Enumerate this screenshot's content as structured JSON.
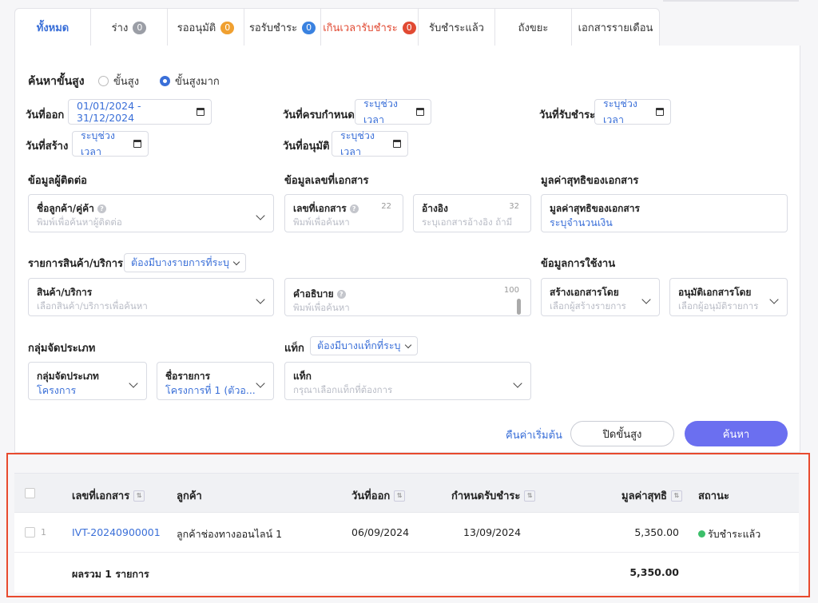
{
  "tabs": [
    {
      "label": "ทั้งหมด"
    },
    {
      "label": "ร่าง",
      "badge": "0",
      "badge_color": "#9b9ea6"
    },
    {
      "label": "รออนุมัติ",
      "badge": "0",
      "badge_color": "#f0a030"
    },
    {
      "label": "รอรับชำระ",
      "badge": "0",
      "badge_color": "#3a82e0"
    },
    {
      "label": "เกินเวลารับชำระ",
      "badge": "0",
      "badge_color": "#e14a33"
    },
    {
      "label": "รับชำระแล้ว"
    },
    {
      "label": "ถังขยะ"
    },
    {
      "label": "เอกสารรายเดือน"
    }
  ],
  "search": {
    "title": "ค้นหาขั้นสูง",
    "mode_advanced": "ขั้นสูง",
    "mode_very_advanced": "ขั้นสูงมาก",
    "issue_date_label": "วันที่ออก",
    "issue_date_value": "01/01/2024 - 31/12/2024",
    "due_date_label": "วันที่ครบกำหนด",
    "due_date_value": "ระบุช่วงเวลา",
    "paid_date_label": "วันที่รับชำระ",
    "paid_date_value": "ระบุช่วงเวลา",
    "created_date_label": "วันที่สร้าง",
    "created_date_value": "ระบุช่วงเวลา",
    "approved_date_label": "วันที่อนุมัติ",
    "approved_date_value": "ระบุช่วงเวลา",
    "contact_section": "ข้อมูลผู้ติดต่อ",
    "doc_section": "ข้อมูลเลขที่เอกสาร",
    "net_section": "มูลค่าสุทธิของเอกสาร",
    "customer_label": "ชื่อลูกค้า/คู่ค้า",
    "customer_placeholder": "พิมพ์เพื่อค้นหาผู้ติดต่อ",
    "docno_label": "เลขที่เอกสาร",
    "docno_count": "22",
    "docno_placeholder": "พิมพ์เพื่อค้นหา",
    "ref_label": "อ้างอิง",
    "ref_count": "32",
    "ref_placeholder": "ระบุเอกสารอ้างอิง ถ้ามี",
    "net_label": "มูลค่าสุทธิของเอกสาร",
    "net_value": "ระบุจำนวนเงิน",
    "product_section": "รายการสินค้า/บริการ",
    "product_filter": "ต้องมีบางรายการที่ระบุ",
    "usage_section": "ข้อมูลการใช้งาน",
    "product_label": "สินค้า/บริการ",
    "product_placeholder": "เลือกสินค้า/บริการเพื่อค้นหา",
    "desc_label": "คำอธิบาย",
    "desc_count": "100",
    "desc_placeholder": "พิมพ์เพื่อค้นหา",
    "createdby_label": "สร้างเอกสารโดย",
    "createdby_placeholder": "เลือกผู้สร้างรายการ",
    "approvedby_label": "อนุมัติเอกสารโดย",
    "approvedby_placeholder": "เลือกผู้อนุมัติรายการ",
    "group_section": "กลุ่มจัดประเภท",
    "tag_section": "แท็ก",
    "tag_filter": "ต้องมีบางแท็กที่ระบุ",
    "group_label": "กลุ่มจัดประเภท",
    "group_value": "โครงการ",
    "listname_label": "ชื่อรายการ",
    "listname_value": "โครงการที่ 1 (ตัวอ...",
    "tag_label": "แท็ก",
    "tag_placeholder": "กรุณาเลือกแท็กที่ต้องการ",
    "reset": "คืนค่าเริ่มต้น",
    "close": "ปิดขั้นสูง",
    "submit": "ค้นหา"
  },
  "table": {
    "headers": {
      "docno": "เลขที่เอกสาร",
      "customer": "ลูกค้า",
      "issue": "วันที่ออก",
      "due": "กำหนดรับชำระ",
      "net": "มูลค่าสุทธิ",
      "status": "สถานะ"
    },
    "sort_icon": "⇅",
    "rows": [
      {
        "index": "1",
        "docno": "IVT-20240900001",
        "customer": "ลูกค้าช่องทางออนไลน์ 1",
        "issue": "06/09/2024",
        "due": "13/09/2024",
        "net": "5,350.00",
        "status": "รับชำระแล้ว"
      }
    ],
    "total_label": "ผลรวม 1 รายการ",
    "total_value": "5,350.00"
  },
  "colors": {
    "accent": "#3a6fd8",
    "primary_button": "#6b6ff0",
    "highlight": "#e84a2e",
    "status_paid": "#3cbf6a"
  }
}
